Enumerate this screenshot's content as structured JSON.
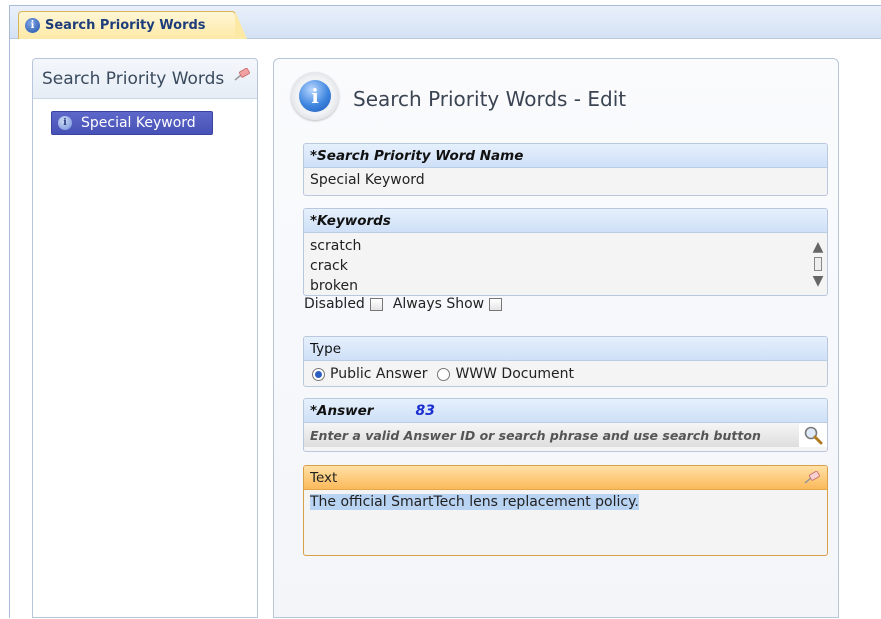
{
  "tab": {
    "label": "Search Priority Words"
  },
  "left_panel": {
    "title": "Search Priority Words",
    "items": [
      {
        "label": "Special Keyword"
      }
    ]
  },
  "editor": {
    "title": "Search Priority Words - Edit",
    "name_field": {
      "label": "*Search Priority Word Name",
      "value": "Special Keyword"
    },
    "keywords_field": {
      "label": "*Keywords",
      "values": [
        "scratch",
        "crack",
        "broken"
      ]
    },
    "flags": {
      "disabled_label": "Disabled",
      "disabled_checked": false,
      "always_show_label": "Always Show",
      "always_show_checked": false
    },
    "type_field": {
      "label": "Type",
      "options": [
        {
          "label": "Public Answer",
          "selected": true
        },
        {
          "label": "WWW Document",
          "selected": false
        }
      ]
    },
    "answer_field": {
      "label": "*Answer",
      "answer_id": "83",
      "placeholder": "Enter a valid Answer ID or search phrase and use search button"
    },
    "text_field": {
      "label": "Text",
      "value": "The official SmartTech lens replacement policy."
    }
  },
  "colors": {
    "tab_bg": "#fde9a6",
    "nav_selected": "#4f5abf",
    "field_header": "#d8e6f9",
    "text_header": "#fbc06a",
    "answer_id": "#1b2fd0"
  }
}
